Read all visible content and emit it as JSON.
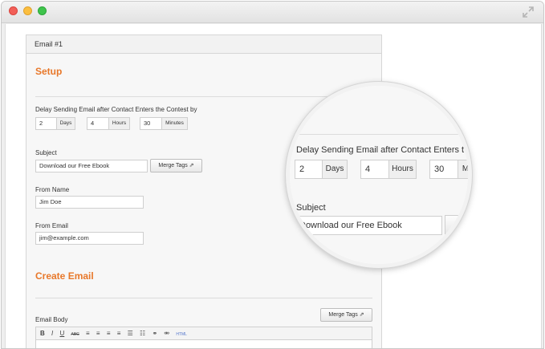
{
  "email": {
    "panel_title": "Email #1",
    "setup_title": "Setup",
    "delay_label": "Delay Sending Email after Contact Enters the Contest by",
    "delay_days_value": "2",
    "delay_days_unit": "Days",
    "delay_hours_value": "4",
    "delay_hours_unit": "Hours",
    "delay_minutes_value": "30",
    "delay_minutes_unit": "Minutes",
    "subject_label": "Subject",
    "subject_value": "Download our Free Ebook",
    "merge_tags_label": "Merge Tags",
    "from_name_label": "From Name",
    "from_name_value": "Jim Doe",
    "from_email_label": "From Email",
    "from_email_value": "jim@example.com",
    "create_email_title": "Create Email",
    "email_body_label": "Email Body",
    "toolbar": {
      "bold": "B",
      "italic": "I",
      "underline": "U",
      "strike": "ABC",
      "html": "HTML"
    }
  },
  "magnified": {
    "delay_label": "Delay Sending Email after Contact Enters t",
    "days_value": "2",
    "days_unit": "Days",
    "hours_value": "4",
    "hours_unit": "Hours",
    "minutes_value": "30",
    "minutes_unit": "M",
    "subject_label": "Subject",
    "subject_value": "Download our Free Ebook"
  }
}
